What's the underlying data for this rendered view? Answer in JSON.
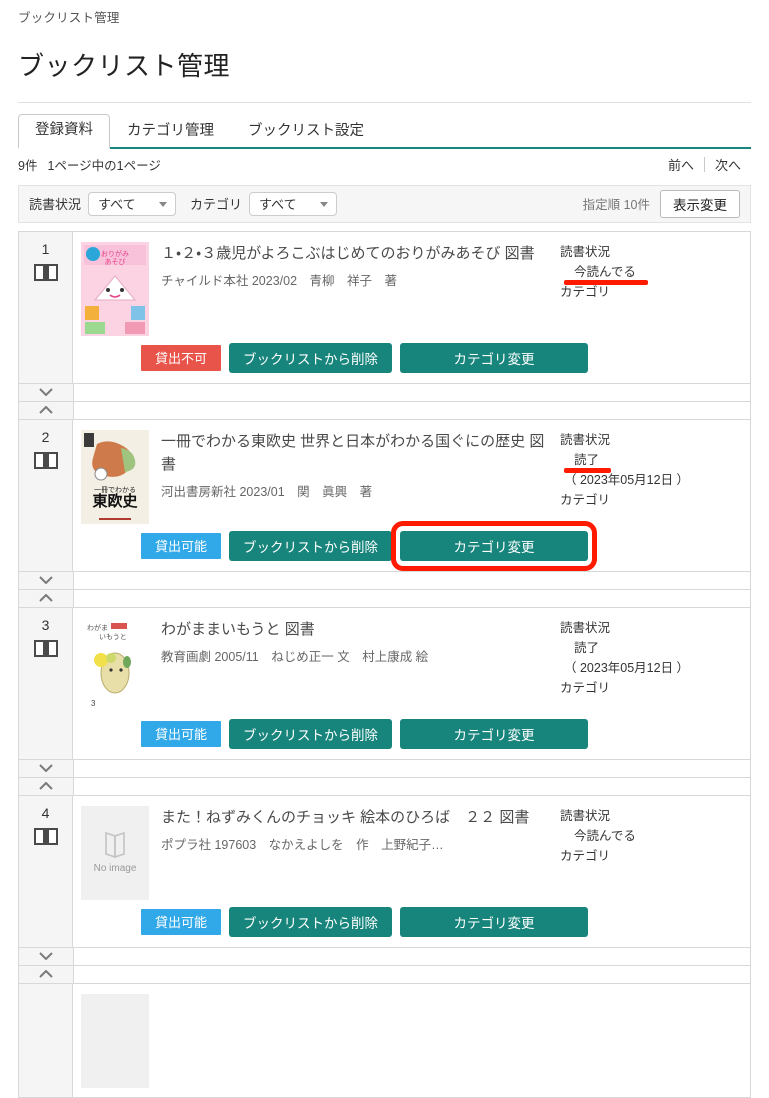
{
  "breadcrumb": "ブックリスト管理",
  "page_title": "ブックリスト管理",
  "tabs": [
    {
      "label": "登録資料",
      "active": true
    },
    {
      "label": "カテゴリ管理",
      "active": false
    },
    {
      "label": "ブックリスト設定",
      "active": false
    }
  ],
  "summary": {
    "count": "9件",
    "paging": "1ページ中の1ページ",
    "prev": "前へ",
    "next": "次へ"
  },
  "filters": {
    "reading_status_label": "読書状況",
    "reading_status_value": "すべて",
    "category_label": "カテゴリ",
    "category_value": "すべて",
    "sort_info": "指定順 10件",
    "view_change_button": "表示変更"
  },
  "labels": {
    "reading_status": "読書状況",
    "category": "カテゴリ",
    "no_image": "No image",
    "delete_button": "ブックリストから削除",
    "change_category_button": "カテゴリ変更",
    "lendable": "貸出可能",
    "not_lendable": "貸出不可"
  },
  "colors": {
    "teal": "#17857c",
    "blue_badge": "#31a9e8",
    "red_badge": "#e8544a",
    "annotation_red": "#ff1a00"
  },
  "items": [
    {
      "index": "1",
      "title": "１・２・３歳児がよろこぶはじめてのおりがみあそび 図書",
      "detail": "チャイルド本社 2023/02　青柳　祥子　著",
      "status_label": "読書状況",
      "status_value": "今読んでる",
      "status_underlined": true,
      "date": "",
      "category_label": "カテゴリ",
      "lend_badge": "貸出不可",
      "lend_state": "ng",
      "delete_button": "ブックリストから削除",
      "category_button": "カテゴリ変更",
      "highlighted": false,
      "cover": "origami"
    },
    {
      "index": "2",
      "title": "一冊でわかる東欧史 世界と日本がわかる国ぐにの歴史 図書",
      "detail": "河出書房新社 2023/01　関　眞興　著",
      "status_label": "読書状況",
      "status_value": "読了",
      "status_underlined": true,
      "date": "（ 2023年05月12日 ）",
      "category_label": "カテゴリ",
      "lend_badge": "貸出可能",
      "lend_state": "ok",
      "delete_button": "ブックリストから削除",
      "category_button": "カテゴリ変更",
      "highlighted": true,
      "cover": "history"
    },
    {
      "index": "3",
      "title": "わがままいもうと 図書",
      "detail": "教育画劇 2005/11　ねじめ正一 文　村上康成 絵",
      "status_label": "読書状況",
      "status_value": "読了",
      "status_underlined": false,
      "date": "（ 2023年05月12日 ）",
      "category_label": "カテゴリ",
      "lend_badge": "貸出可能",
      "lend_state": "ok",
      "delete_button": "ブックリストから削除",
      "category_button": "カテゴリ変更",
      "highlighted": false,
      "cover": "imouto"
    },
    {
      "index": "4",
      "title": "また！ねずみくんのチョッキ 絵本のひろば　２２ 図書",
      "detail": "ポプラ社 197603　なかえよしを　作　上野紀子…",
      "status_label": "読書状況",
      "status_value": "今読んでる",
      "status_underlined": false,
      "date": "",
      "category_label": "カテゴリ",
      "lend_badge": "貸出可能",
      "lend_state": "ok",
      "delete_button": "ブックリストから削除",
      "category_button": "カテゴリ変更",
      "highlighted": false,
      "cover": "none"
    }
  ]
}
